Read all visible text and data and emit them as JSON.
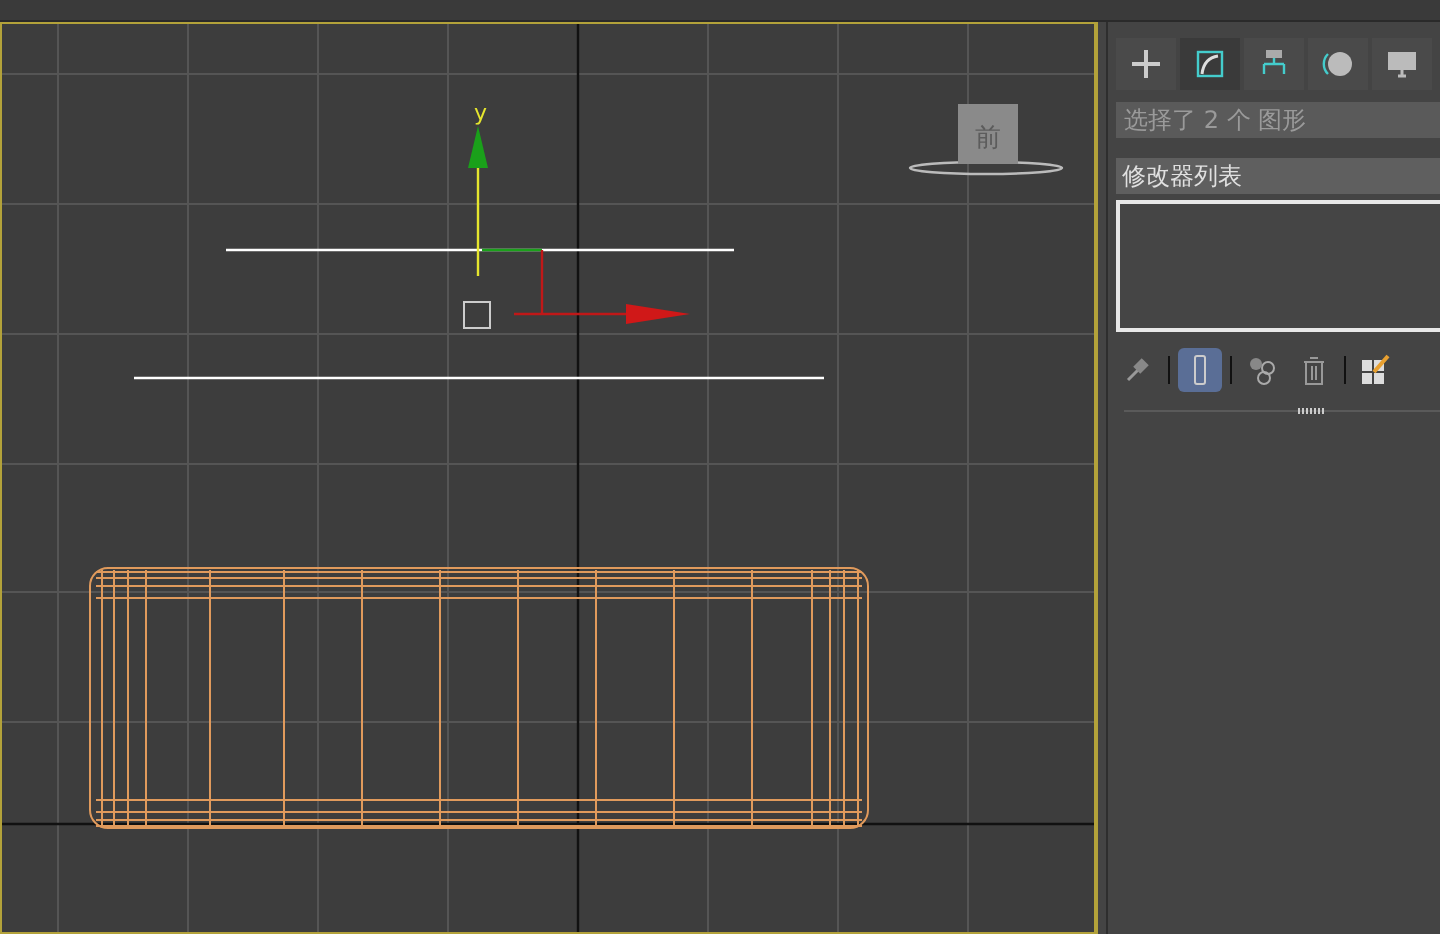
{
  "viewport": {
    "gizmo_axis_label": "y",
    "viewcube_label": "前"
  },
  "command_panel": {
    "tabs": [
      {
        "kind": "create",
        "selected": false
      },
      {
        "kind": "modify",
        "selected": true
      },
      {
        "kind": "hierarchy",
        "selected": false
      },
      {
        "kind": "motion",
        "selected": false
      },
      {
        "kind": "display",
        "selected": false
      }
    ],
    "selection_name": "选择了 2 个 图形",
    "modifier_list": "修改器列表",
    "stack_tools": [
      {
        "kind": "pin",
        "on": false
      },
      {
        "kind": "end-result",
        "on": true
      },
      {
        "kind": "unique",
        "on": false
      },
      {
        "kind": "remove",
        "on": false
      },
      {
        "kind": "configure",
        "on": false
      }
    ]
  }
}
